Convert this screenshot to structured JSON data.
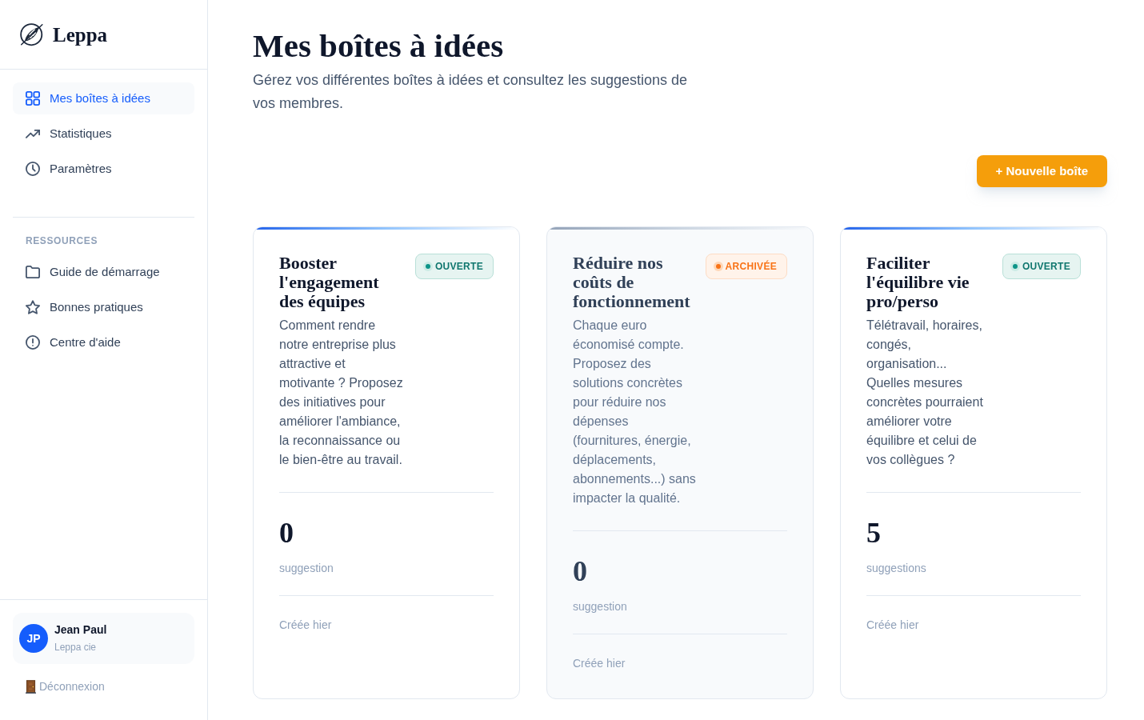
{
  "sidebar": {
    "brand": "Leppa",
    "nav": [
      {
        "label": "Mes boîtes à idées",
        "selected": true
      },
      {
        "label": "Statistiques",
        "selected": false
      },
      {
        "label": "Paramètres",
        "selected": false
      }
    ],
    "section_title": "RESSOURCES",
    "resources": [
      {
        "label": "Guide de démarrage",
        "selected": false
      },
      {
        "label": "Bonnes pratiques",
        "selected": false
      },
      {
        "label": "Centre d'aide",
        "selected": false
      }
    ],
    "user": {
      "initials": "JP",
      "name": "Jean Paul",
      "company": "Leppa cie"
    },
    "logout": "Déconnexion"
  },
  "header": {
    "title": "Mes boîtes à idées",
    "subtitle": "Gérez vos différentes boîtes à idées et consultez les suggestions de vos membres."
  },
  "new_button": "+ Nouvelle boîte",
  "cards": [
    {
      "kind": "open",
      "title": "Booster l'engagement des équipes",
      "badge": "OUVERTE",
      "description": "Comment rendre notre entreprise plus attractive et motivante ? Proposez des initiatives pour améliorer l'ambiance, la reconnaissance ou le bien-être au travail.",
      "count": "0",
      "count_label": "suggestion",
      "created": "Créée hier"
    },
    {
      "kind": "archived",
      "title": "Réduire nos coûts de fonctionnement",
      "badge": "ARCHIVÉE",
      "description": "Chaque euro économisé compte. Proposez des solutions concrètes pour réduire nos dépenses (fournitures, énergie, déplacements, abonnements...) sans impacter la qualité.",
      "count": "0",
      "count_label": "suggestion",
      "created": "Créée hier"
    },
    {
      "kind": "open",
      "title": "Faciliter l'équilibre vie pro/perso",
      "badge": "OUVERTE",
      "description": "Télétravail, horaires, congés, organisation... Quelles mesures concrètes pourraient améliorer votre équilibre et celui de vos collègues ?",
      "count": "5",
      "count_label": "suggestions",
      "created": "Créée hier"
    }
  ]
}
